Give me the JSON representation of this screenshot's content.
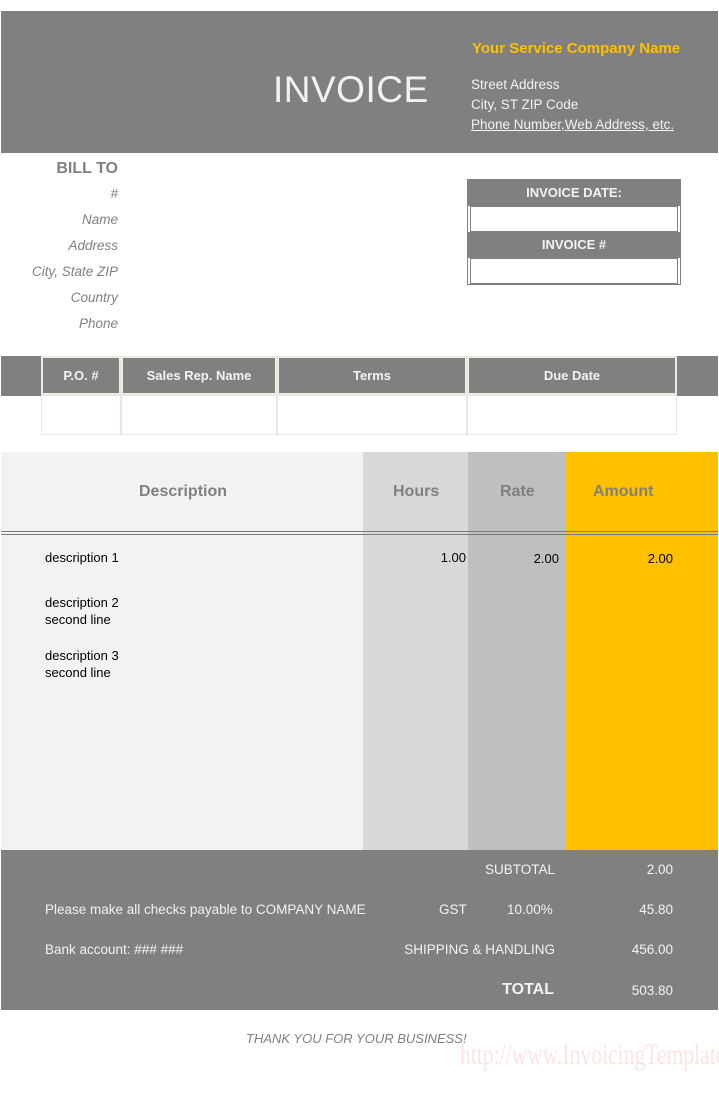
{
  "header": {
    "title": "INVOICE",
    "company_name": "Your Service Company Name",
    "street": "Street Address",
    "city": "City, ST  ZIP Code",
    "contact": "Phone Number,Web Address, etc."
  },
  "bill_to": {
    "heading": "BILL TO",
    "fields": [
      "#",
      "Name",
      "Address",
      "City, State ZIP",
      "Country",
      "Phone"
    ]
  },
  "invoice_info": {
    "date_label": "INVOICE DATE:",
    "date_value": "",
    "number_label": "INVOICE #",
    "number_value": ""
  },
  "order_table": {
    "headers": [
      "P.O. #",
      "Sales Rep. Name",
      "Terms",
      "Due Date"
    ],
    "values": [
      "",
      "",
      "",
      ""
    ]
  },
  "items": {
    "headers": {
      "description": "Description",
      "hours": "Hours",
      "rate": "Rate",
      "amount": "Amount"
    },
    "rows": [
      {
        "line1": "description 1",
        "line2": "",
        "hours": "1.00",
        "rate": "2.00",
        "amount": "2.00"
      },
      {
        "line1": "description 2",
        "line2": "second line",
        "hours": "",
        "rate": "",
        "amount": ""
      },
      {
        "line1": "description 3",
        "line2": "second line",
        "hours": "",
        "rate": "",
        "amount": ""
      }
    ]
  },
  "totals": {
    "note1": "Please make all checks payable to COMPANY NAME",
    "note2": "Bank account: ### ###",
    "subtotal_label": "SUBTOTAL",
    "subtotal": "2.00",
    "tax_label": "GST",
    "tax_rate": "10.00%",
    "tax": "45.80",
    "shipping_label": "SHIPPING & HANDLING",
    "shipping": "456.00",
    "total_label": "TOTAL",
    "total": "503.80"
  },
  "footer": {
    "thanks": "THANK YOU FOR YOUR BUSINESS!",
    "watermark": "http://www.InvoicingTemplate.com"
  },
  "colors": {
    "band_gray": "#808080",
    "accent_yellow": "#ffc000",
    "desc_col": "#f2f2f2",
    "hours_col": "#d8d8d8",
    "rate_col": "#bfbfbf"
  }
}
